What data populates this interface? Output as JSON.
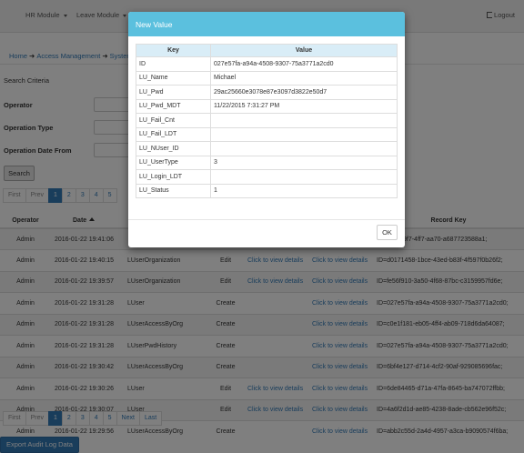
{
  "nav": {
    "items": [
      "HR Module",
      "Leave Module"
    ],
    "logout": "Logout"
  },
  "breadcrumb": [
    "Home",
    "Access Management",
    "System"
  ],
  "search": {
    "title": "Search Criteria",
    "fields": [
      "Operator",
      "Operation Type",
      "Operation Date From"
    ],
    "button": "Search"
  },
  "pagination": [
    "First",
    "Prev",
    "1",
    "2",
    "3",
    "4",
    "5",
    "Next",
    "Last"
  ],
  "pagination_top": [
    "First",
    "Prev",
    "1",
    "2",
    "3",
    "4",
    "5"
  ],
  "table": {
    "headers": [
      "Operator",
      "Date",
      "",
      "",
      "",
      "",
      "Record Key"
    ],
    "rows": [
      [
        "Admin",
        "2016-01-22 19:41:06",
        "",
        "",
        "",
        "",
        "ID=59d-d9f7-4ff7-aa70-a687723588a1;"
      ],
      [
        "Admin",
        "2016-01-22 19:40:15",
        "LUserOrganization",
        "Edit",
        "Click to view details",
        "Click to view details",
        "ID=d0171458-1bce-43ed-b83f-4f597f0b26f2;"
      ],
      [
        "Admin",
        "2016-01-22 19:39:57",
        "LUserOrganization",
        "Edit",
        "Click to view details",
        "Click to view details",
        "ID=fe56f910-3a50-4f68-87bc-c3159957fd6e;"
      ],
      [
        "Admin",
        "2016-01-22 19:31:28",
        "LUser",
        "Create",
        "",
        "Click to view details",
        "ID=027e57fa-a94a-4508-9307-75a3771a2cd0;"
      ],
      [
        "Admin",
        "2016-01-22 19:31:28",
        "LUserAccessByOrg",
        "Create",
        "",
        "Click to view details",
        "ID=c0e1f181-eb05-4ff4-ab09-718d6da64087;"
      ],
      [
        "Admin",
        "2016-01-22 19:31:28",
        "LUserPwdHistory",
        "Create",
        "",
        "Click to view details",
        "ID=027e57fa-a94a-4508-9307-75a3771a2cd0;"
      ],
      [
        "Admin",
        "2016-01-22 19:30:42",
        "LUserAccessByOrg",
        "Create",
        "",
        "Click to view details",
        "ID=6bf4e127-d714-4cf2-90af-929085696fac;"
      ],
      [
        "Admin",
        "2016-01-22 19:30:26",
        "LUser",
        "Edit",
        "Click to view details",
        "Click to view details",
        "ID=6de84465-d71a-47fa-8645-ba747072ffbb;"
      ],
      [
        "Admin",
        "2016-01-22 19:30:07",
        "LUser",
        "Edit",
        "Click to view details",
        "Click to view details",
        "ID=4a6f2d1d-ae85-4238-8ade-cb562e96f52c;"
      ],
      [
        "Admin",
        "2016-01-22 19:29:56",
        "LUserAccessByOrg",
        "Create",
        "",
        "Click to view details",
        "ID=abb2c55d-2a4d-4957-a3ca-b9090574f6ba;"
      ]
    ]
  },
  "export_button": "Export Audit Log Data",
  "modal": {
    "title": "New Value",
    "headers": [
      "Key",
      "Value"
    ],
    "rows": [
      [
        "ID",
        "027e57fa-a94a-4508-9307-75a3771a2cd0"
      ],
      [
        "LU_Name",
        "Michael"
      ],
      [
        "LU_Pwd",
        "29ac25660e3078e87e3097d3822e50d7"
      ],
      [
        "LU_Pwd_MDT",
        "11/22/2015 7:31:27 PM"
      ],
      [
        "LU_Fail_Cnt",
        ""
      ],
      [
        "LU_Fail_LDT",
        ""
      ],
      [
        "LU_NUser_ID",
        ""
      ],
      [
        "LU_UserType",
        "3"
      ],
      [
        "LU_Login_LDT",
        ""
      ],
      [
        "LU_Status",
        "1"
      ]
    ],
    "ok_button": "OK"
  },
  "colors": {
    "modal_header": "#5bc0de",
    "primary": "#337ab7",
    "key_header": "#d9edf7"
  }
}
